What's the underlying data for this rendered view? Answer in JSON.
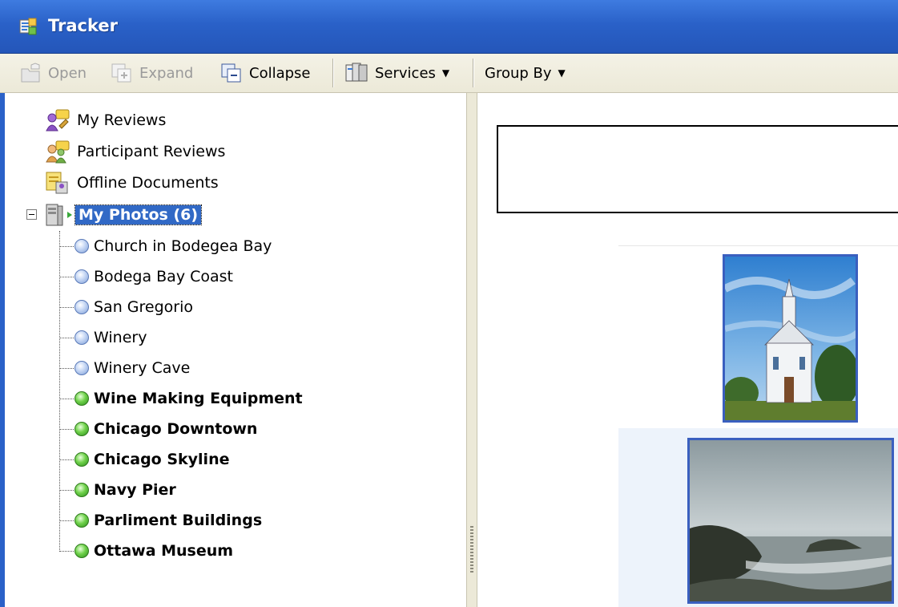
{
  "window": {
    "title": "Tracker"
  },
  "toolbar": {
    "open_label": "Open",
    "expand_label": "Expand",
    "collapse_label": "Collapse",
    "services_label": "Services",
    "groupby_label": "Group By"
  },
  "tree": {
    "top_items": [
      {
        "label": "My Reviews",
        "icon": "my-reviews-icon"
      },
      {
        "label": "Participant Reviews",
        "icon": "participant-reviews-icon"
      },
      {
        "label": "Offline Documents",
        "icon": "offline-documents-icon"
      }
    ],
    "root": {
      "label": "My Photos (6)",
      "icon": "server-folder-icon",
      "expanded": true
    },
    "children": [
      {
        "label": "Church in Bodegea Bay",
        "status": "blue",
        "bold": false
      },
      {
        "label": "Bodega Bay Coast",
        "status": "blue",
        "bold": false
      },
      {
        "label": "San Gregorio",
        "status": "blue",
        "bold": false
      },
      {
        "label": "Winery",
        "status": "blue",
        "bold": false
      },
      {
        "label": "Winery Cave",
        "status": "blue",
        "bold": false
      },
      {
        "label": "Wine Making Equipment",
        "status": "green",
        "bold": true
      },
      {
        "label": "Chicago Downtown",
        "status": "green",
        "bold": true
      },
      {
        "label": "Chicago Skyline",
        "status": "green",
        "bold": true
      },
      {
        "label": "Navy Pier",
        "status": "green",
        "bold": true
      },
      {
        "label": "Parliment Buildings",
        "status": "green",
        "bold": true
      },
      {
        "label": "Ottawa Museum",
        "status": "green",
        "bold": true
      }
    ]
  },
  "colors": {
    "title_bar": "#2a61c8",
    "selection": "#3169c6",
    "photo_border": "#3a5fbf",
    "status_blue": "#7e9fd8",
    "status_green": "#3fae2a"
  }
}
